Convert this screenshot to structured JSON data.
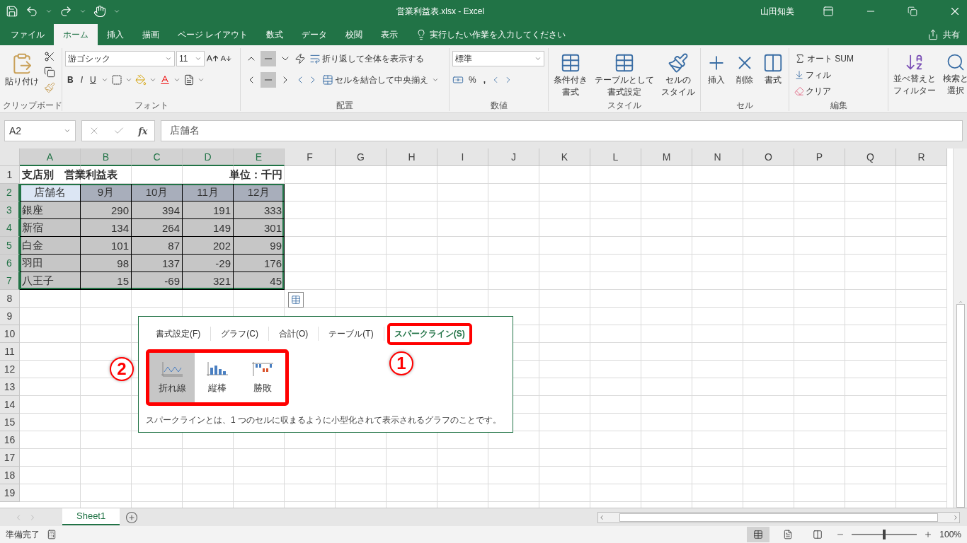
{
  "title_bar": {
    "title": "営業利益表.xlsx  -  Excel",
    "user": "山田知美"
  },
  "menu_tabs": [
    {
      "label": "ファイル",
      "selected": false
    },
    {
      "label": "ホーム",
      "selected": true
    },
    {
      "label": "挿入",
      "selected": false
    },
    {
      "label": "描画",
      "selected": false
    },
    {
      "label": "ページ レイアウト",
      "selected": false
    },
    {
      "label": "数式",
      "selected": false
    },
    {
      "label": "データ",
      "selected": false
    },
    {
      "label": "校閲",
      "selected": false
    },
    {
      "label": "表示",
      "selected": false
    }
  ],
  "tell_me": "実行したい作業を入力してください",
  "share": "共有",
  "ribbon": {
    "clipboard": {
      "paste": "貼り付け",
      "label": "クリップボード"
    },
    "font": {
      "name": "游ゴシック",
      "size": "11",
      "bold": "B",
      "italic": "I",
      "underline": "U",
      "label": "フォント"
    },
    "alignment": {
      "vertical": [
        {
          "selected": false
        },
        {
          "selected": true
        },
        {
          "selected": false
        }
      ],
      "horizontal": [
        {
          "selected": false
        },
        {
          "selected": true
        },
        {
          "selected": false
        }
      ],
      "wrap": "折り返して全体を表示する",
      "merge": "セルを結合して中央揃え",
      "label": "配置"
    },
    "number": {
      "format": "標準",
      "percent": "%",
      "comma": ",",
      "label": "数値"
    },
    "styles": {
      "buttons": [
        {
          "kind": "conditional",
          "lines": [
            "条件付き",
            "書式"
          ]
        },
        {
          "kind": "table",
          "lines": [
            "テーブルとして",
            "書式設定"
          ]
        },
        {
          "kind": "cellstyle",
          "lines": [
            "セルの",
            "スタイル"
          ]
        }
      ],
      "label": "スタイル"
    },
    "cells": {
      "buttons": [
        {
          "kind": "insert",
          "lines": [
            "挿入"
          ]
        },
        {
          "kind": "delete",
          "lines": [
            "削除"
          ]
        },
        {
          "kind": "format",
          "lines": [
            "書式"
          ]
        }
      ],
      "label": "セル"
    },
    "editing": {
      "autosum": "オート SUM",
      "fill": "フィル",
      "clear": "クリア",
      "sort": [
        "並べ替えと",
        "フィルター"
      ],
      "find": [
        "検索と",
        "選択"
      ],
      "label": "編集"
    }
  },
  "formula_bar": {
    "name_box": "A2",
    "fx": "fx",
    "value": "店舗名"
  },
  "columns": [
    {
      "label": "A",
      "selected": true
    },
    {
      "label": "B",
      "selected": true
    },
    {
      "label": "C",
      "selected": true
    },
    {
      "label": "D",
      "selected": true
    },
    {
      "label": "E",
      "selected": true
    },
    {
      "label": "F",
      "selected": false
    },
    {
      "label": "G",
      "selected": false
    },
    {
      "label": "H",
      "selected": false
    },
    {
      "label": "I",
      "selected": false
    },
    {
      "label": "J",
      "selected": false
    },
    {
      "label": "K",
      "selected": false
    },
    {
      "label": "L",
      "selected": false
    },
    {
      "label": "M",
      "selected": false
    },
    {
      "label": "N",
      "selected": false
    },
    {
      "label": "O",
      "selected": false
    },
    {
      "label": "P",
      "selected": false
    },
    {
      "label": "Q",
      "selected": false
    },
    {
      "label": "R",
      "selected": false
    }
  ],
  "rows": [
    {
      "label": "1",
      "kind": "title",
      "selected": false,
      "cells": [
        {
          "text": "支店別　営業利益表",
          "active": false
        },
        {
          "text": "単位：千円",
          "active": false
        }
      ]
    },
    {
      "label": "2",
      "kind": "header",
      "selected": true,
      "cells": [
        {
          "text": "店舗名",
          "active": true
        },
        {
          "text": "9月",
          "active": false
        },
        {
          "text": "10月",
          "active": false
        },
        {
          "text": "11月",
          "active": false
        },
        {
          "text": "12月",
          "active": false
        }
      ]
    },
    {
      "label": "3",
      "kind": "data",
      "selected": true,
      "cells": [
        {
          "text": "銀座",
          "active": false
        },
        {
          "text": "290",
          "active": false
        },
        {
          "text": "394",
          "active": false
        },
        {
          "text": "191",
          "active": false
        },
        {
          "text": "333",
          "active": false
        }
      ]
    },
    {
      "label": "4",
      "kind": "data",
      "selected": true,
      "cells": [
        {
          "text": "新宿",
          "active": false
        },
        {
          "text": "134",
          "active": false
        },
        {
          "text": "264",
          "active": false
        },
        {
          "text": "149",
          "active": false
        },
        {
          "text": "301",
          "active": false
        }
      ]
    },
    {
      "label": "5",
      "kind": "data",
      "selected": true,
      "cells": [
        {
          "text": "白金",
          "active": false
        },
        {
          "text": "101",
          "active": false
        },
        {
          "text": "87",
          "active": false
        },
        {
          "text": "202",
          "active": false
        },
        {
          "text": "99",
          "active": false
        }
      ]
    },
    {
      "label": "6",
      "kind": "data",
      "selected": true,
      "cells": [
        {
          "text": "羽田",
          "active": false
        },
        {
          "text": "98",
          "active": false
        },
        {
          "text": "137",
          "active": false
        },
        {
          "text": "-29",
          "active": false
        },
        {
          "text": "176",
          "active": false
        }
      ]
    },
    {
      "label": "7",
      "kind": "data",
      "selected": true,
      "cells": [
        {
          "text": "八王子",
          "active": false
        },
        {
          "text": "15",
          "active": false
        },
        {
          "text": "-69",
          "active": false
        },
        {
          "text": "321",
          "active": false
        },
        {
          "text": "45",
          "active": false
        }
      ]
    },
    {
      "label": "8",
      "kind": "empty",
      "selected": false,
      "cells": []
    },
    {
      "label": "9",
      "kind": "empty",
      "selected": false,
      "cells": []
    },
    {
      "label": "10",
      "kind": "empty",
      "selected": false,
      "cells": []
    },
    {
      "label": "11",
      "kind": "empty",
      "selected": false,
      "cells": []
    },
    {
      "label": "12",
      "kind": "empty",
      "selected": false,
      "cells": []
    },
    {
      "label": "13",
      "kind": "empty",
      "selected": false,
      "cells": []
    },
    {
      "label": "14",
      "kind": "empty",
      "selected": false,
      "cells": []
    },
    {
      "label": "15",
      "kind": "empty",
      "selected": false,
      "cells": []
    },
    {
      "label": "16",
      "kind": "empty",
      "selected": false,
      "cells": []
    },
    {
      "label": "17",
      "kind": "empty",
      "selected": false,
      "cells": []
    },
    {
      "label": "18",
      "kind": "empty",
      "selected": false,
      "cells": []
    },
    {
      "label": "19",
      "kind": "empty",
      "selected": false,
      "cells": []
    }
  ],
  "quick_analysis": {
    "tabs": [
      {
        "label": "書式設定(F)",
        "selected": false,
        "highlighted": false
      },
      {
        "label": "グラフ(C)",
        "selected": false,
        "highlighted": false
      },
      {
        "label": "合計(O)",
        "selected": false,
        "highlighted": false
      },
      {
        "label": "テーブル(T)",
        "selected": false,
        "highlighted": false
      },
      {
        "label": "スパークライン(S)",
        "selected": true,
        "highlighted": true
      }
    ],
    "items_highlighted": true,
    "items": [
      {
        "kind": "line",
        "label": "折れ線",
        "selected": true
      },
      {
        "kind": "column",
        "label": "縦棒",
        "selected": false
      },
      {
        "kind": "winloss",
        "label": "勝敗",
        "selected": false
      }
    ],
    "description": "スパークラインとは、1 つのセルに収まるように小型化されて表示されるグラフのことです。",
    "callouts": [
      {
        "label": "1"
      },
      {
        "label": "2"
      }
    ]
  },
  "sheet_tabs": [
    {
      "label": "Sheet1",
      "selected": true
    }
  ],
  "status_bar": {
    "status": "準備完了",
    "zoom": "100%",
    "zoom_level": {
      "level": 0.5
    }
  }
}
